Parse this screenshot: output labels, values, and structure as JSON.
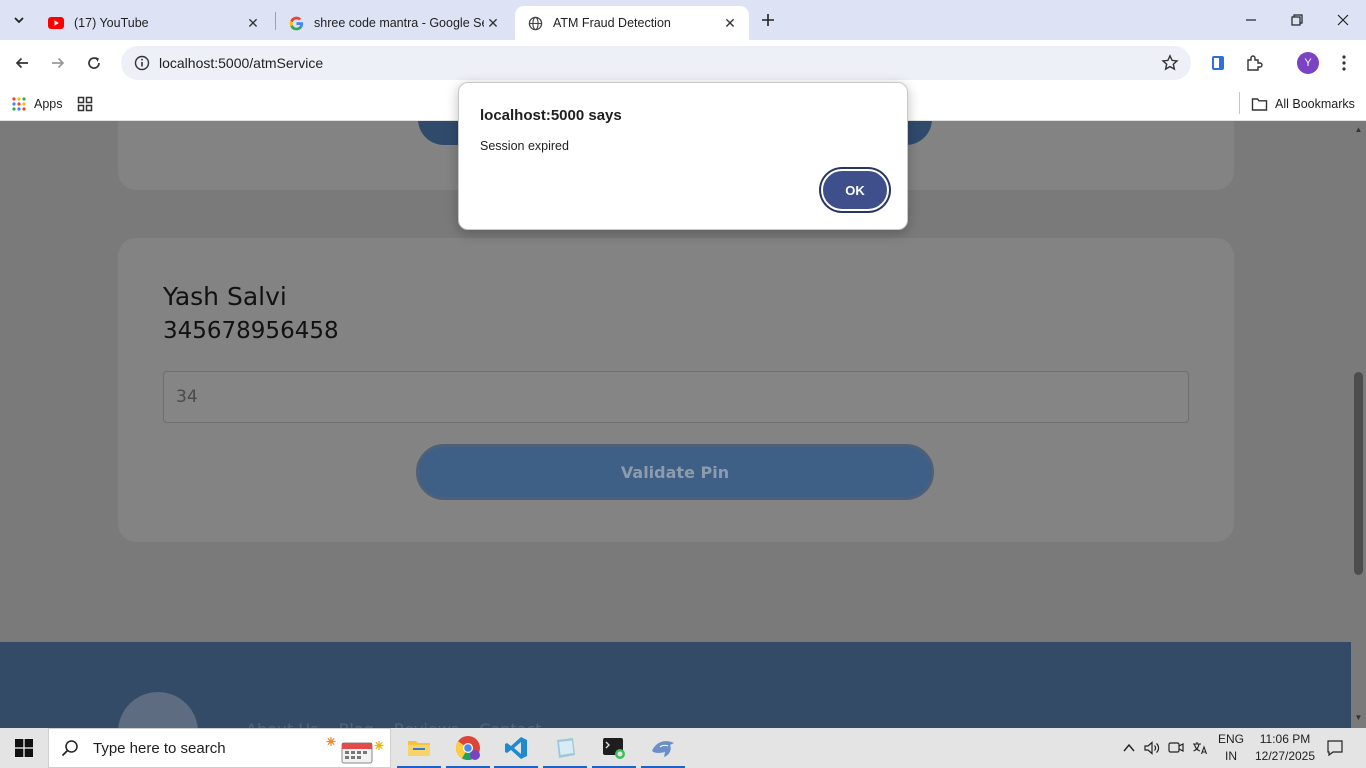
{
  "browser": {
    "tabs": [
      {
        "title": "(17) YouTube",
        "favicon": "youtube-icon",
        "active": false
      },
      {
        "title": "shree code mantra - Google Se",
        "favicon": "google-icon",
        "active": false
      },
      {
        "title": "ATM Fraud Detection",
        "favicon": "globe-icon",
        "active": true
      }
    ],
    "address_bar": {
      "url": "localhost:5000/atmService"
    },
    "bookmarks": {
      "apps_label": "Apps",
      "all_bookmarks_label": "All Bookmarks"
    },
    "profile_initial": "Y"
  },
  "page": {
    "customer_name": "Yash Salvi",
    "account_number": "345678956458",
    "pin_input_value": "34",
    "validate_button_label": "Validate Pin",
    "footer_links": [
      "About Us",
      "Blog",
      "Reviews",
      "Contact"
    ]
  },
  "dialog": {
    "title": "localhost:5000 says",
    "message": "Session expired",
    "ok_label": "OK"
  },
  "taskbar": {
    "search_placeholder": "Type here to search",
    "language_line1": "ENG",
    "language_line2": "IN",
    "time": "11:06 PM",
    "date": "12/27/2025"
  },
  "colors": {
    "accent": "#3e4f8c",
    "page_overlay": "#7a7a7a",
    "footer": "#344b67",
    "tabstrip": "#dde3f5"
  }
}
